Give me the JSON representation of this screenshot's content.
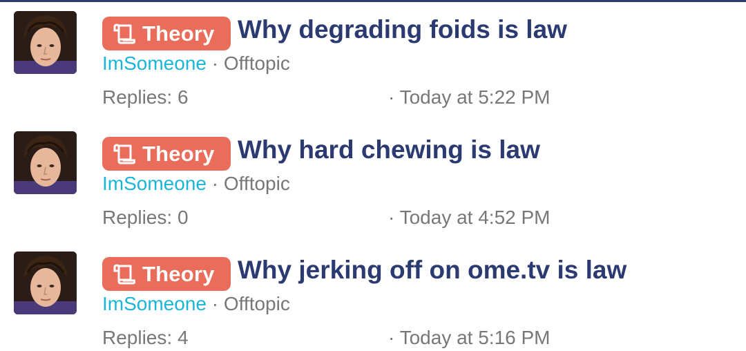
{
  "threads": [
    {
      "prefix": "Theory",
      "title": "Why degrading foids is law",
      "author": "ImSomeone",
      "separator": "·",
      "forum": "Offtopic",
      "replies_label": "Replies: 6",
      "date": "· Today at 5:22 PM"
    },
    {
      "prefix": "Theory",
      "title": "Why hard chewing is law",
      "author": "ImSomeone",
      "separator": "·",
      "forum": "Offtopic",
      "replies_label": "Replies: 0",
      "date": "· Today at 4:52 PM"
    },
    {
      "prefix": "Theory",
      "title": "Why jerking off on ome.tv is law",
      "author": "ImSomeone",
      "separator": "·",
      "forum": "Offtopic",
      "replies_label": "Replies: 4",
      "date": "· Today at 5:16 PM"
    }
  ],
  "colors": {
    "prefix_badge": "#e96d5a",
    "title": "#2c3a72",
    "author": "#1bb5d6",
    "muted": "#777777",
    "top_border": "#2f3d6c"
  },
  "icons": {
    "prefix": "scroll-icon",
    "avatar": "user-avatar"
  }
}
